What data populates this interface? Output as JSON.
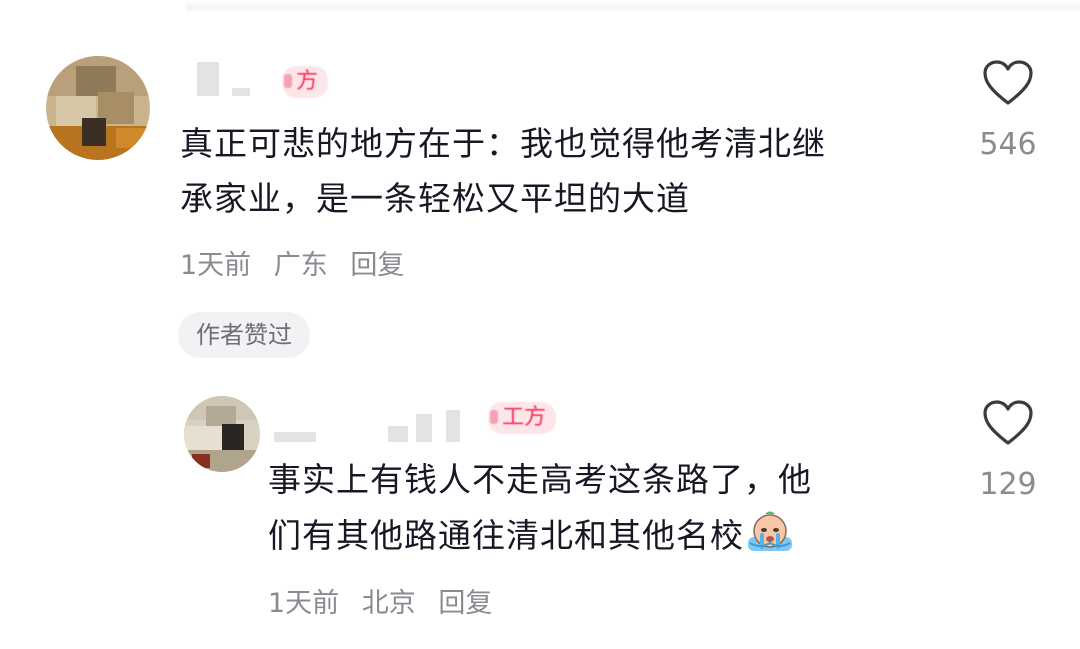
{
  "comments": [
    {
      "badge": "方",
      "text_line1": "真正可悲的地方在于：我也觉得他考清北继",
      "text_line2": "承家业，是一条轻松又平坦的大道",
      "time": "1天前",
      "location": "广东",
      "reply_label": "回复",
      "author_liked_tag": "作者赞过",
      "like_count": "546",
      "icon": "heart-icon"
    },
    {
      "badge": "工方",
      "text_line1": "事实上有钱人不走高考这条路了，他",
      "text_line2": "们有其他路通往清北和其他名校",
      "emoji": "crying-emoji-icon",
      "time": "1天前",
      "location": "北京",
      "reply_label": "回复",
      "like_count": "129",
      "icon": "heart-icon"
    }
  ],
  "colors": {
    "accent": "#fe2c55",
    "text": "#161823",
    "meta": "#8a8b91",
    "tag_bg": "#f2f2f4"
  }
}
